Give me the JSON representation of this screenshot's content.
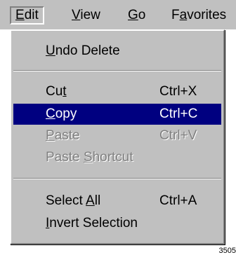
{
  "menubar": {
    "items": [
      {
        "label": "Edit",
        "mnemonic": "E",
        "active": true
      },
      {
        "label": "View",
        "mnemonic": "V"
      },
      {
        "label": "Go",
        "mnemonic": "G"
      },
      {
        "label": "Favorites",
        "mnemonic": "a"
      }
    ]
  },
  "edit_menu": {
    "undo": {
      "label": "Undo Delete",
      "mnemonic": "U"
    },
    "cut": {
      "label": "Cut",
      "mnemonic": "t",
      "shortcut": "Ctrl+X"
    },
    "copy": {
      "label": "Copy",
      "mnemonic": "C",
      "shortcut": "Ctrl+C",
      "selected": true
    },
    "paste": {
      "label": "Paste",
      "mnemonic": "P",
      "shortcut": "Ctrl+V",
      "enabled": false
    },
    "paste_shortcut": {
      "label": "Paste Shortcut",
      "mnemonic": "S",
      "enabled": false
    },
    "select_all": {
      "label": "Select All",
      "mnemonic": "A",
      "shortcut": "Ctrl+A"
    },
    "invert": {
      "label": "Invert Selection",
      "mnemonic": "I"
    }
  },
  "figure_number": "3505",
  "colors": {
    "menu_bg": "#c0c0c0",
    "highlight": "#000080",
    "disabled_text": "#808080"
  }
}
